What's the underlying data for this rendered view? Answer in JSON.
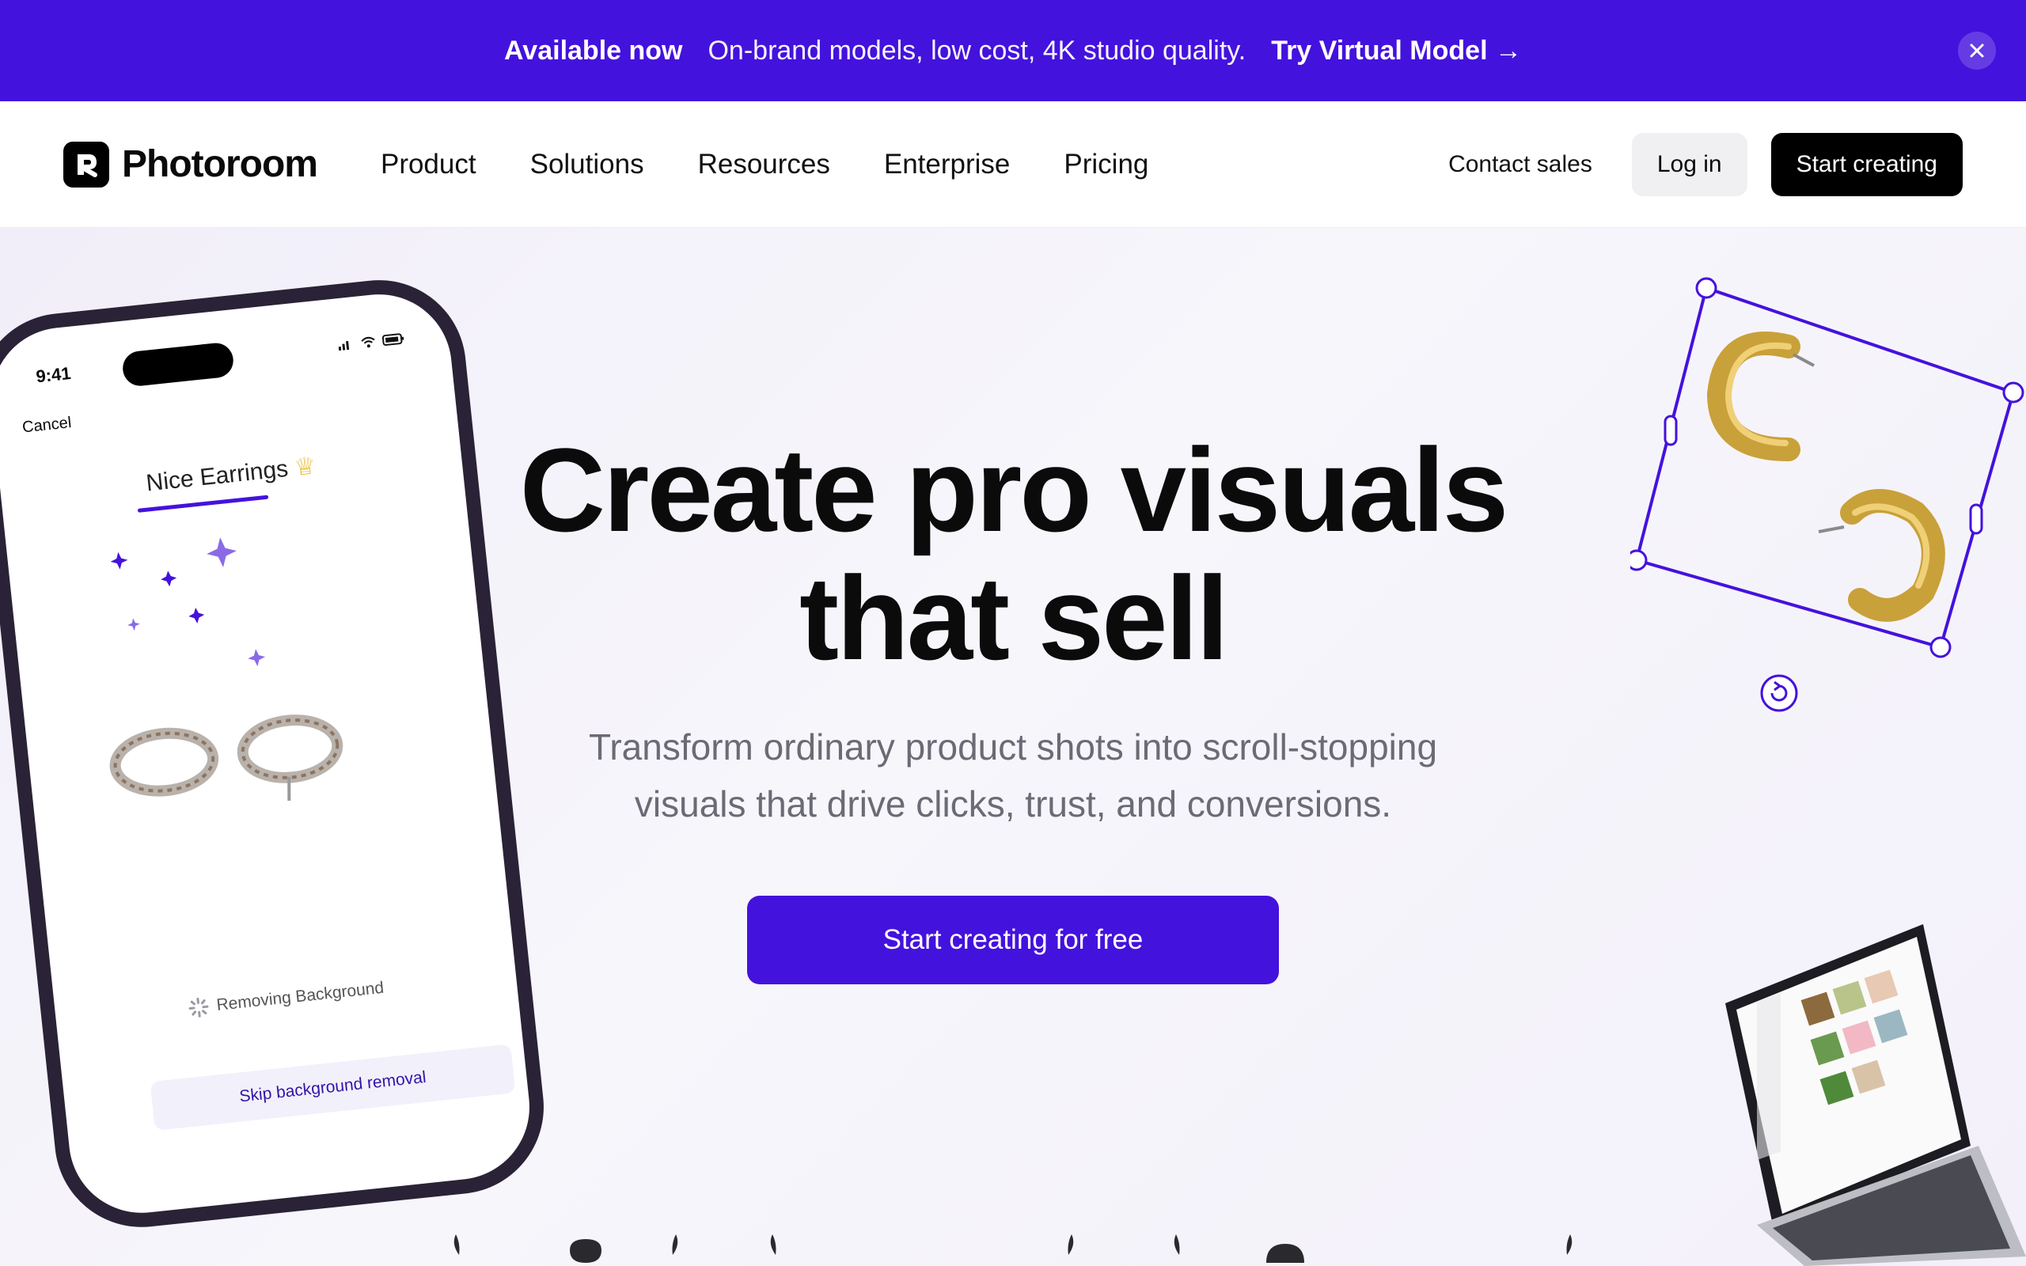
{
  "banner": {
    "badge": "Available now",
    "message": "On-brand models, low cost, 4K studio quality.",
    "link": "Try Virtual Model →",
    "close_icon": "close-icon"
  },
  "nav": {
    "brand": "Photoroom",
    "items": [
      "Product",
      "Solutions",
      "Resources",
      "Enterprise",
      "Pricing"
    ],
    "contact": "Contact sales",
    "login": "Log in",
    "start": "Start creating"
  },
  "hero": {
    "headline_line1": "Create pro visuals",
    "headline_line2": "that sell",
    "sub_line1": "Transform ordinary product shots into scroll-stopping",
    "sub_line2": "visuals that drive clicks, trust, and conversions.",
    "cta": "Start creating for free"
  },
  "phone": {
    "time": "9:41",
    "cancel": "Cancel",
    "title": "Nice Earrings",
    "status": "Removing Background",
    "skip": "Skip background removal"
  },
  "colors": {
    "accent": "#4412dd",
    "dark": "#0b0b0b",
    "muted": "#6b6b75"
  }
}
